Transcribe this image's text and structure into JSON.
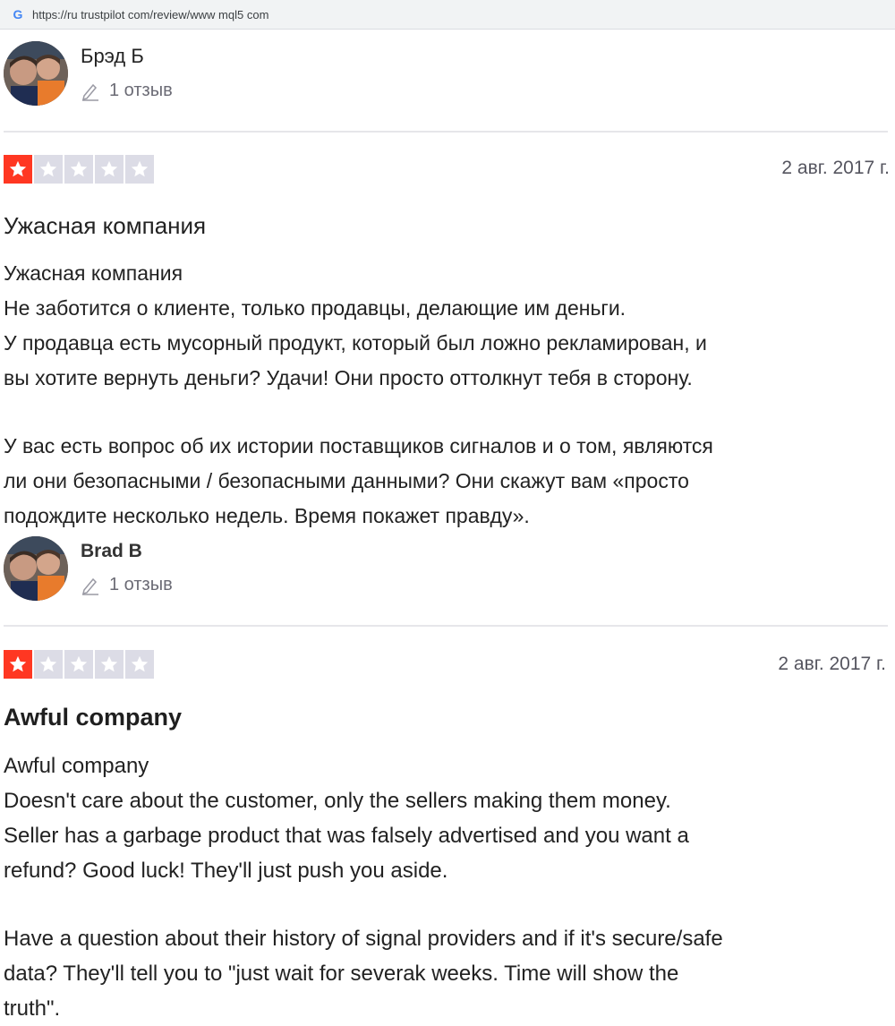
{
  "browser": {
    "favicon": "G",
    "url": "https://ru trustpilot com/review/www mql5 com"
  },
  "reviews": [
    {
      "reviewer_name": "Брэд Б",
      "review_count": "1 отзыв",
      "rating": 1,
      "max_rating": 5,
      "date": "2 авг. 2017 г.",
      "title": "Ужасная компания",
      "body_lines": [
        "Ужасная компания",
        "Не заботится о клиенте, только продавцы, делающие им деньги.",
        "У продавца есть мусорный продукт, который был ложно рекламирован, и",
        "вы хотите вернуть деньги? Удачи! Они просто оттолкнут тебя в сторону."
      ],
      "body_lines_2": [
        "У вас есть вопрос об их истории поставщиков сигналов и о том, являются",
        "ли они безопасными / безопасными данными? Они скажут вам «просто",
        "подождите несколько недель. Время покажет правду»."
      ]
    },
    {
      "reviewer_name": "Brad B",
      "review_count": "1 отзыв",
      "rating": 1,
      "max_rating": 5,
      "date": "2 авг. 2017 г.",
      "title": "Awful company",
      "body_lines": [
        "Awful company",
        "Doesn't care about the customer, only the sellers making them money.",
        "Seller has a garbage product that was falsely advertised and you want a",
        "refund? Good luck! They'll just push you aside."
      ],
      "body_lines_2": [
        "Have a question about their history of signal providers and if it's secure/safe",
        "data? They'll tell you to \"just wait for severak weeks. Time will show the",
        "truth\"."
      ]
    }
  ],
  "colors": {
    "star_filled": "#ff3722",
    "star_empty": "#dcdce6",
    "divider": "#e6e6ea"
  },
  "icons": [
    "google-favicon",
    "avatar-photo",
    "pencil-icon",
    "star-icon"
  ]
}
